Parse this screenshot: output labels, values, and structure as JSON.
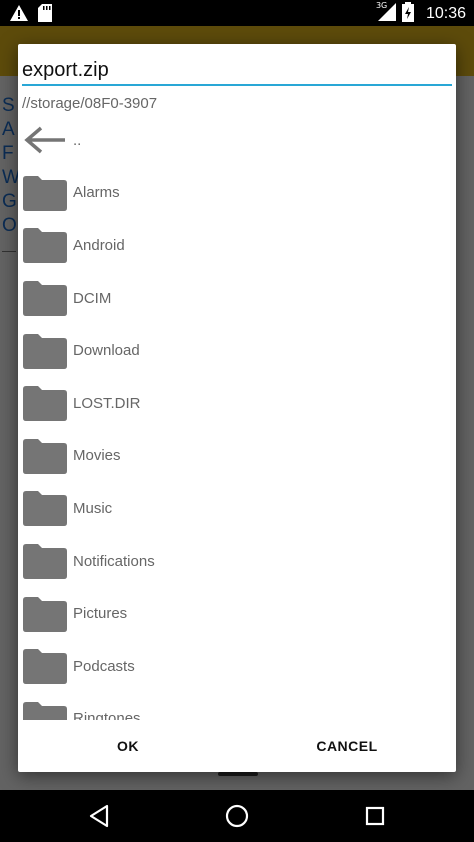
{
  "status_bar": {
    "time": "10:36",
    "network": "3G",
    "icons": [
      "warning-icon",
      "sd-card-icon",
      "signal-icon",
      "battery-icon"
    ]
  },
  "background_app": {
    "toolbar_color": "#e9bb1d",
    "lines": [
      "S",
      "A",
      "F",
      "W",
      "G",
      "O"
    ],
    "faint_line": "—"
  },
  "dialog": {
    "filename": "export.zip",
    "path": "//storage/08F0-3907",
    "entries": [
      {
        "label": "..",
        "icon": "back-arrow-icon"
      },
      {
        "label": "Alarms",
        "icon": "folder-icon"
      },
      {
        "label": "Android",
        "icon": "folder-icon"
      },
      {
        "label": "DCIM",
        "icon": "folder-icon"
      },
      {
        "label": "Download",
        "icon": "folder-icon"
      },
      {
        "label": "LOST.DIR",
        "icon": "folder-icon"
      },
      {
        "label": "Movies",
        "icon": "folder-icon"
      },
      {
        "label": "Music",
        "icon": "folder-icon"
      },
      {
        "label": "Notifications",
        "icon": "folder-icon"
      },
      {
        "label": "Pictures",
        "icon": "folder-icon"
      },
      {
        "label": "Podcasts",
        "icon": "folder-icon"
      },
      {
        "label": "Ringtones",
        "icon": "folder-icon"
      }
    ],
    "ok_label": "OK",
    "cancel_label": "CANCEL",
    "accent_color": "#29a7d6",
    "folder_color": "#757575"
  },
  "nav": {
    "icons": [
      "back-triangle-icon",
      "home-circle-icon",
      "recents-square-icon"
    ]
  }
}
